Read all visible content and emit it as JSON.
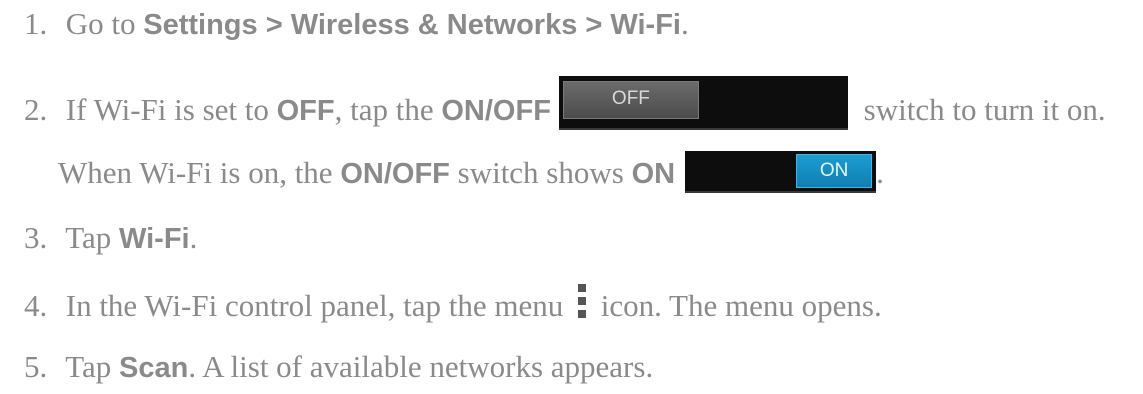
{
  "steps": [
    {
      "number": "1.",
      "text_before": "Go to ",
      "bold": "Settings > Wireless & Networks > Wi-Fi",
      "text_after": "."
    },
    {
      "number": "2.",
      "text_1": "If Wi-Fi is set to ",
      "bold_1": "OFF",
      "text_2": ", tap the ",
      "bold_2": "ON/OFF",
      "switch_label": "OFF",
      "text_3": " switch to turn it on.",
      "cont_text_1": "When Wi-Fi is on, the ",
      "cont_bold_1": "ON/OFF",
      "cont_text_2": " switch shows ",
      "cont_bold_2": "ON",
      "cont_switch_label": "ON",
      "cont_text_3": "."
    },
    {
      "number": "3.",
      "text_before": "Tap ",
      "bold": "Wi-Fi",
      "text_after": "."
    },
    {
      "number": "4.",
      "text_before": "In the Wi-Fi control panel, tap the menu ",
      "icon": "overflow-menu-icon",
      "text_after": " icon. The menu opens."
    },
    {
      "number": "5.",
      "text_before": "Tap ",
      "bold": "Scan",
      "text_after": ". A list of available networks appears."
    }
  ],
  "colors": {
    "text": "#8a8a8a",
    "switch_bg": "#0d0d0d",
    "off_knob": "#5b5b5b",
    "on_knob": "#1590c6"
  }
}
